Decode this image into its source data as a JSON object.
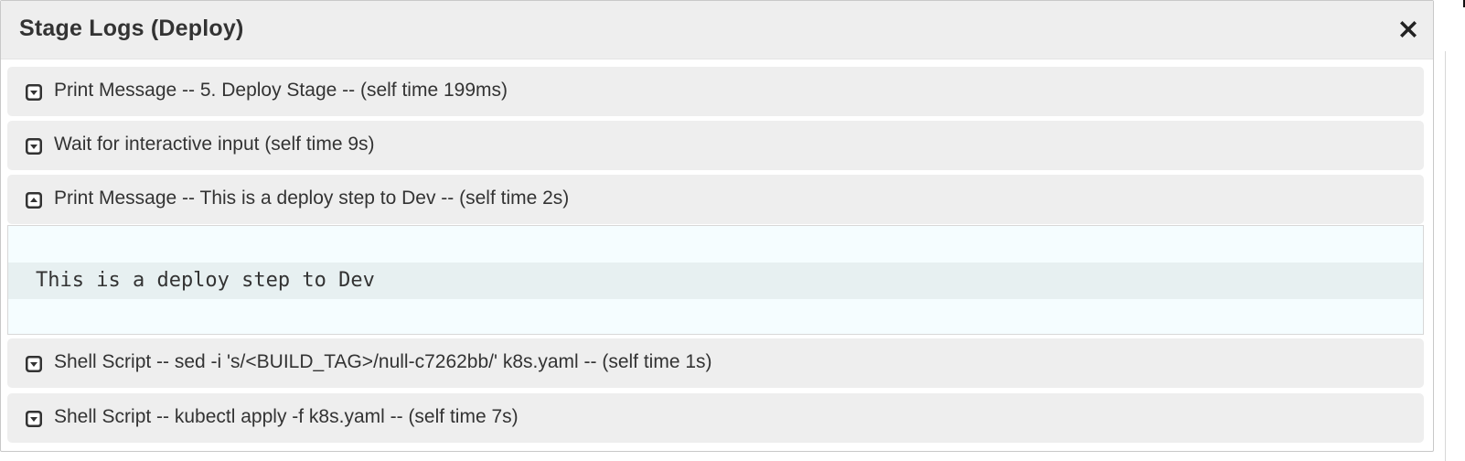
{
  "dialog": {
    "title": "Stage Logs (Deploy)",
    "close_icon": "close-icon"
  },
  "steps": [
    {
      "label": "Print Message -- 5. Deploy Stage -- (self time 199ms)",
      "expanded": false
    },
    {
      "label": "Wait for interactive input (self time 9s)",
      "expanded": false
    },
    {
      "label": "Print Message -- This is a deploy step to Dev -- (self time 2s)",
      "expanded": true
    },
    {
      "label": "Shell Script -- sed -i 's/<BUILD_TAG>/null-c7262bb/' k8s.yaml -- (self time 1s)",
      "expanded": false
    },
    {
      "label": "Shell Script -- kubectl apply -f k8s.yaml -- (self time 7s)",
      "expanded": false
    }
  ],
  "log": {
    "lines": [
      "This is a deploy step to Dev"
    ]
  },
  "colors": {
    "header_bg": "#eeeeee",
    "step_bg": "#eeeeee",
    "log_bg": "#f5fdff",
    "log_line_highlight": "#e7f0f1",
    "text": "#333333"
  }
}
